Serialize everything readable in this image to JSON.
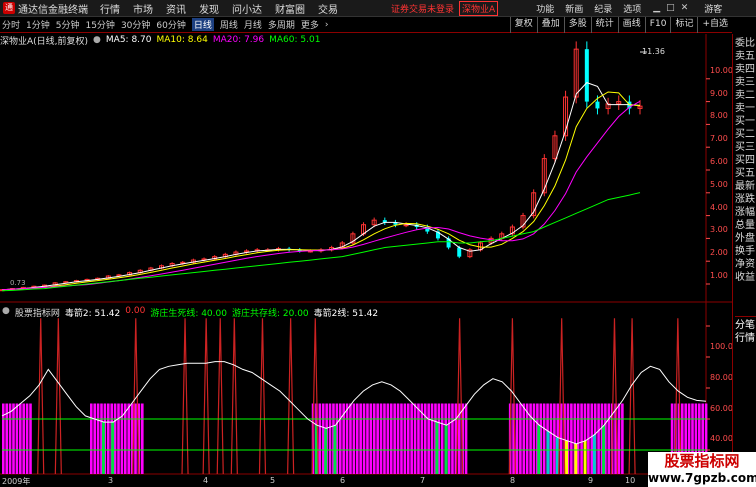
{
  "titlebar": {
    "app_name": "通达信金融终端",
    "menus": [
      "行情",
      "市场",
      "资讯",
      "发现",
      "问小达",
      "财富圈",
      "交易"
    ],
    "warning": "证券交易未登录",
    "stock_box": "深物业A",
    "right_menus": [
      "功能",
      "新画",
      "纪录",
      "选项"
    ],
    "guest": "游客"
  },
  "periodbar": {
    "periods": [
      "分时",
      "1分钟",
      "5分钟",
      "15分钟",
      "30分钟",
      "60分钟",
      "日线",
      "周线",
      "月线",
      "多周期",
      "更多"
    ],
    "active": "日线",
    "more_arrow": "›",
    "tools": [
      "复权",
      "叠加",
      "多股",
      "统计",
      "画线",
      "F10",
      "标记",
      "+自选"
    ]
  },
  "mainchart": {
    "title": "深物业A(日线,前复权)",
    "ma": [
      {
        "label": "MA5: 8.70",
        "color": "#ffffff"
      },
      {
        "label": "MA10: 8.64",
        "color": "#ffff00"
      },
      {
        "label": "MA20: 7.96",
        "color": "#ff00ff"
      },
      {
        "label": "MA60: 5.01",
        "color": "#00ff00"
      }
    ],
    "y_labels": [
      "10.00",
      "9.00",
      "8.00",
      "7.00",
      "6.00",
      "5.00",
      "4.00",
      "3.00",
      "2.00",
      "1.00"
    ],
    "y_values": [
      10,
      9,
      8,
      7,
      6,
      5,
      4,
      3,
      2,
      1
    ],
    "high_label": "11.36",
    "low_label": "0.73",
    "close_series": [
      0.75,
      0.8,
      0.85,
      0.9,
      0.95,
      1.05,
      1.1,
      1.15,
      1.2,
      1.25,
      1.35,
      1.4,
      1.5,
      1.6,
      1.7,
      1.8,
      1.9,
      1.95,
      2.05,
      2.1,
      2.2,
      2.3,
      2.4,
      2.45,
      2.5,
      2.5,
      2.55,
      2.5,
      2.45,
      2.45,
      2.5,
      2.6,
      2.8,
      3.2,
      3.6,
      3.8,
      3.7,
      3.6,
      3.6,
      3.5,
      3.3,
      3.0,
      2.6,
      2.2,
      2.5,
      2.8,
      3.0,
      3.2,
      3.5,
      4.0,
      5.0,
      6.5,
      7.5,
      9.2,
      11.3,
      9.0,
      8.7,
      8.9,
      9.0,
      8.7,
      8.8
    ],
    "ma60_series": [
      0.7,
      0.72,
      0.75,
      0.78,
      0.8,
      0.85,
      0.9,
      0.95,
      1.0,
      1.05,
      1.1,
      1.15,
      1.2,
      1.25,
      1.3,
      1.35,
      1.4,
      1.45,
      1.5,
      1.55,
      1.6,
      1.65,
      1.7,
      1.75,
      1.8,
      1.85,
      1.9,
      1.95,
      2.0,
      2.05,
      2.1,
      2.15,
      2.2,
      2.3,
      2.4,
      2.5,
      2.6,
      2.65,
      2.7,
      2.75,
      2.8,
      2.85,
      2.85,
      2.8,
      2.8,
      2.85,
      2.9,
      3.0,
      3.1,
      3.2,
      3.3,
      3.5,
      3.7,
      3.9,
      4.1,
      4.3,
      4.5,
      4.7,
      4.8,
      4.9,
      5.01
    ]
  },
  "indicator": {
    "name": "股票指标网",
    "lines": [
      {
        "label": "毒箭2: 51.42",
        "color": "#ffffff"
      },
      {
        "label": "0.00",
        "color": "#ff3333"
      },
      {
        "label": "游庄生死线: 40.00",
        "color": "#00ff00"
      },
      {
        "label": "游庄共存线: 20.00",
        "color": "#00ff00"
      },
      {
        "label": "毒箭2线: 51.42",
        "color": "#ffffff"
      }
    ],
    "y_labels": [
      "100.00",
      "80.00",
      "60.00",
      "40.00",
      "20.00"
    ],
    "y_values": [
      100,
      80,
      60,
      40,
      20
    ],
    "curve": [
      42,
      45,
      50,
      55,
      62,
      72,
      64,
      56,
      48,
      42,
      40,
      38,
      38,
      42,
      50,
      58,
      66,
      72,
      74,
      75,
      76,
      76,
      76,
      77,
      77,
      75,
      72,
      70,
      66,
      62,
      58,
      52,
      46,
      40,
      36,
      34,
      36,
      44,
      52,
      58,
      62,
      64,
      62,
      58,
      52,
      46,
      40,
      38,
      36,
      40,
      48,
      56,
      62,
      66,
      64,
      58,
      50,
      42,
      36,
      32,
      28,
      26,
      24,
      26,
      30,
      36,
      44,
      52,
      62,
      70,
      74,
      72,
      64,
      58,
      54,
      52,
      51.42
    ],
    "zones": [
      {
        "start": 0.0,
        "end": 0.04
      },
      {
        "start": 0.125,
        "end": 0.2
      },
      {
        "start": 0.44,
        "end": 0.66
      },
      {
        "start": 0.72,
        "end": 0.88
      },
      {
        "start": 0.95,
        "end": 1.0
      }
    ],
    "spikes": [
      0.055,
      0.08,
      0.19,
      0.26,
      0.29,
      0.31,
      0.33,
      0.37,
      0.41,
      0.445,
      0.65,
      0.725,
      0.795,
      0.87,
      0.895,
      0.96
    ]
  },
  "x_axis": [
    "2009年",
    "3",
    "4",
    "5",
    "6",
    "7",
    "8",
    "9",
    "10"
  ],
  "right_panel": [
    "委比",
    "卖五",
    "卖四",
    "卖三",
    "卖二",
    "卖一",
    "买一",
    "买二",
    "买三",
    "买四",
    "买五",
    "最新",
    "涨跌",
    "涨幅",
    "总量",
    "外盘",
    "换手",
    "净资",
    "收益",
    "分笔",
    "行情"
  ],
  "watermark": {
    "line1": "股票指标网",
    "line2": "www.7gpzb.com"
  },
  "colors": {
    "up": "#ff3333",
    "down": "#00ffff",
    "zone": "#ff00ff",
    "axis": "#8b0000"
  }
}
